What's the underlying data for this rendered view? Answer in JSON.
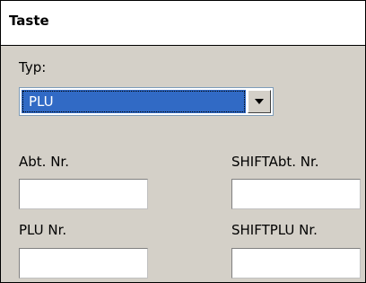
{
  "window": {
    "title": "Taste"
  },
  "typ": {
    "label": "Typ:",
    "selected": "PLU"
  },
  "fields": {
    "abt_nr": {
      "label": "Abt. Nr.",
      "value": ""
    },
    "shift_abt_nr": {
      "label": "SHIFTAbt. Nr.",
      "value": ""
    },
    "plu_nr": {
      "label": "PLU Nr.",
      "value": ""
    },
    "shift_plu_nr": {
      "label": "SHIFTPLU Nr.",
      "value": ""
    }
  },
  "icons": {
    "dropdown": "triangle-down-icon"
  }
}
